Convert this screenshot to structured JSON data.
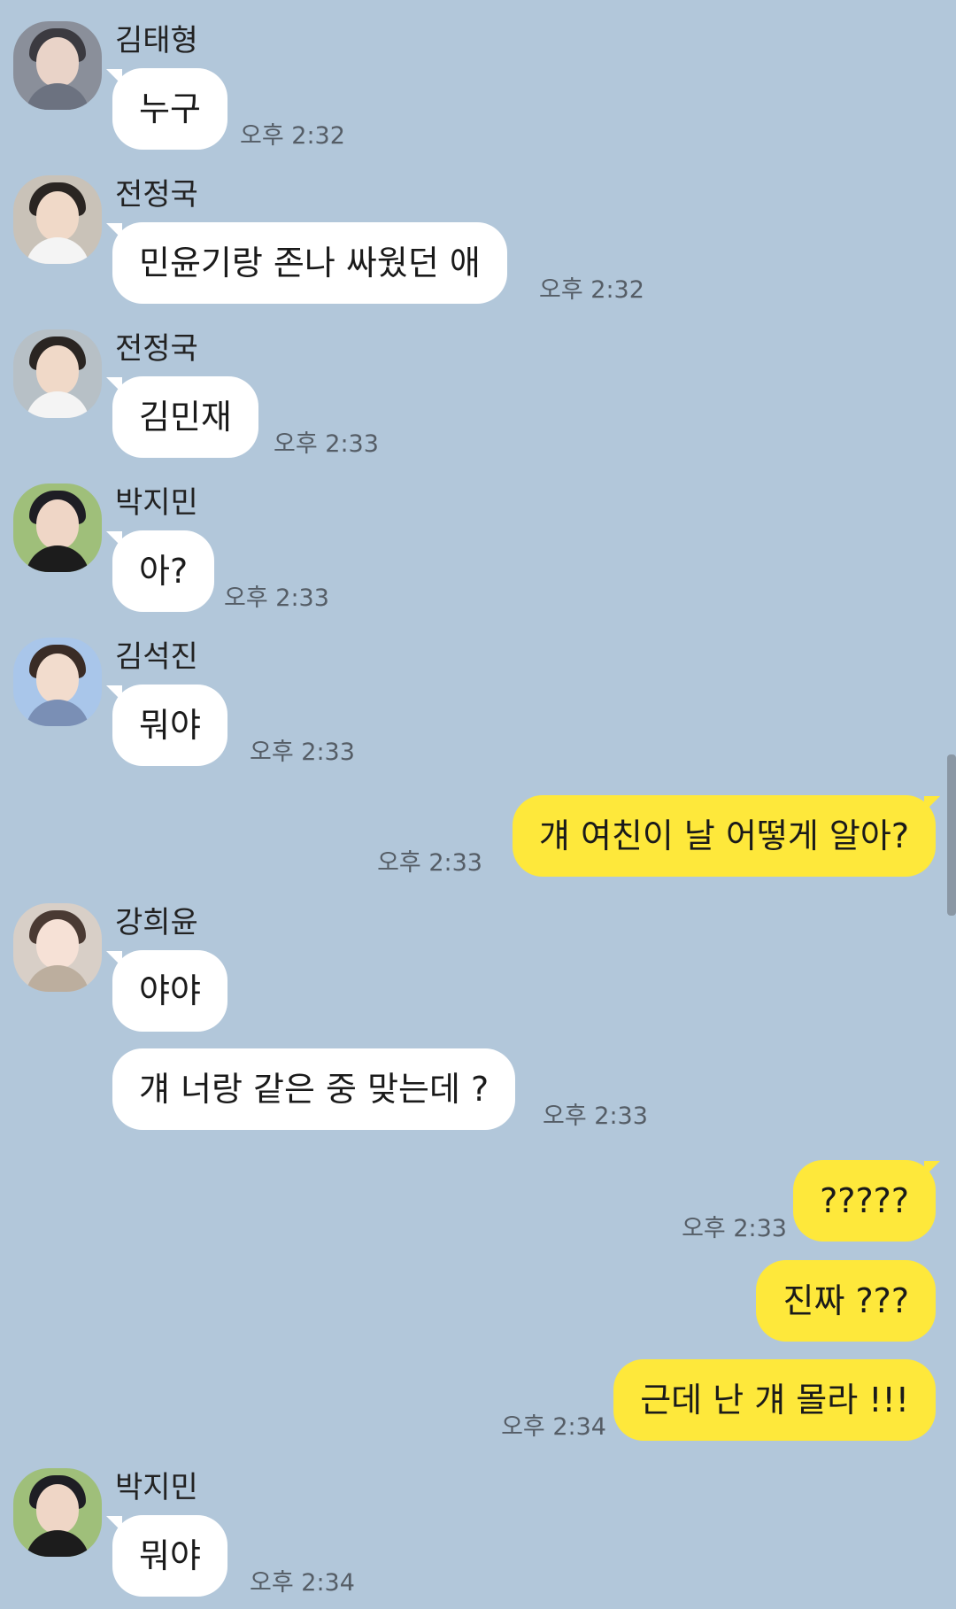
{
  "messages": [
    {
      "sender": "김태형",
      "text": "누구",
      "time": "오후 2:32"
    },
    {
      "sender": "전정국",
      "text": "민윤기랑 존나 싸웠던 애",
      "time": "오후 2:32"
    },
    {
      "sender": "전정국",
      "text": "김민재",
      "time": "오후 2:33"
    },
    {
      "sender": "박지민",
      "text": "아?",
      "time": "오후 2:33"
    },
    {
      "sender": "김석진",
      "text": "뭐야",
      "time": "오후 2:33"
    },
    {
      "text": "걔 여친이 날 어떻게 알아?",
      "time": "오후 2:33"
    },
    {
      "sender": "강희윤",
      "text": "야야"
    },
    {
      "text": "걔 너랑 같은 중 맞는데 ?",
      "time": "오후 2:33"
    },
    {
      "text": "?????",
      "time": "오후 2:33"
    },
    {
      "text": "진짜 ???"
    },
    {
      "text": "근데 난 걔 몰라 !!!",
      "time": "오후 2:34"
    },
    {
      "sender": "박지민",
      "text": "뭐야",
      "time": "오후 2:34"
    }
  ],
  "colors": {
    "background": "#b2c7da",
    "incoming_bubble": "#ffffff",
    "outgoing_bubble": "#fee83b",
    "timestamp": "#555d66"
  }
}
